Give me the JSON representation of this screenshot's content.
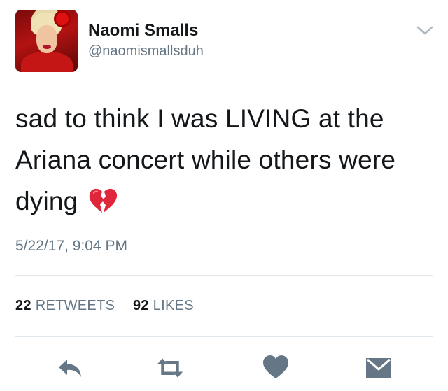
{
  "user": {
    "display_name": "Naomi Smalls",
    "handle": "@naomismallsduh"
  },
  "tweet": {
    "text": "sad to think I was LIVING at the Ariana concert while others were dying",
    "emoji": "broken-heart-emoji",
    "timestamp": "5/22/17, 9:04 PM"
  },
  "stats": {
    "retweets_count": "22",
    "retweets_label": "RETWEETS",
    "likes_count": "92",
    "likes_label": "LIKES"
  },
  "actions": {
    "reply_icon": "reply-icon",
    "retweet_icon": "retweet-icon",
    "like_icon": "heart-icon",
    "message_icon": "envelope-icon"
  },
  "colors": {
    "text_primary": "#14171a",
    "text_secondary": "#657786",
    "icon_gray": "#657786",
    "divider": "#e1e8ed",
    "broken_heart": "#e0263a"
  }
}
